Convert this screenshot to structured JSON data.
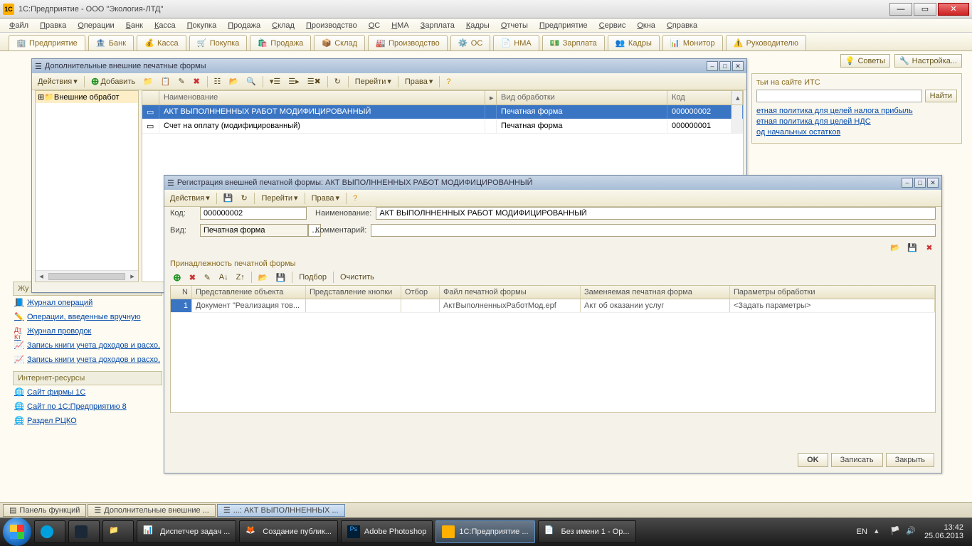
{
  "titlebar": {
    "app": "1С:Предприятие - ООО \"Экология-ЛТД\""
  },
  "menubar": [
    "Файл",
    "Правка",
    "Операции",
    "Банк",
    "Касса",
    "Покупка",
    "Продажа",
    "Склад",
    "Производство",
    "ОС",
    "НМА",
    "Зарплата",
    "Кадры",
    "Отчеты",
    "Предприятие",
    "Сервис",
    "Окна",
    "Справка"
  ],
  "tabs": [
    "Предприятие",
    "Банк",
    "Касса",
    "Покупка",
    "Продажа",
    "Склад",
    "Производство",
    "ОС",
    "НМА",
    "Зарплата",
    "Кадры",
    "Монитор",
    "Руководителю"
  ],
  "right": {
    "tips": "Советы",
    "setup": "Настройка...",
    "section_title": "тьи на сайте ИТС",
    "search_btn": "Найти",
    "links": [
      "етная политика для целей налога прибыль",
      "етная политика для целей НДС",
      "од начальных остатков"
    ]
  },
  "left": {
    "grp_journals": "Жу",
    "items1": [
      "Журнал операций",
      "Операции, введенные вручную",
      "Журнал проводок",
      "Запись книги учета доходов и расхо,",
      "Запись книги учета доходов и расхо,"
    ],
    "grp_inet": "Интернет-ресурсы",
    "items2": [
      "Сайт фирмы 1С",
      "Сайт по 1С:Предприятию 8",
      "Раздел РЦКО"
    ]
  },
  "win1": {
    "title": "Дополнительные внешние печатные формы",
    "actions": "Действия",
    "add": "Добавить",
    "goto": "Перейти",
    "rights": "Права",
    "tree_root": "Внешние обработ",
    "cols": {
      "name": "Наименование",
      "type": "Вид обработки",
      "code": "Код"
    },
    "rows": [
      {
        "name": "АКТ ВЫПОЛННЕННЫХ РАБОТ МОДИФИЦИРОВАННЫЙ",
        "type": "Печатная форма",
        "code": "000000002"
      },
      {
        "name": "Счет на оплату (модифицированный)",
        "type": "Печатная форма",
        "code": "000000001"
      }
    ]
  },
  "win2": {
    "title": "Регистрация внешней печатной формы: АКТ ВЫПОЛННЕННЫХ РАБОТ МОДИФИЦИРОВАННЫЙ",
    "actions": "Действия",
    "goto": "Перейти",
    "rights": "Права",
    "lbl_code": "Код:",
    "val_code": "000000002",
    "lbl_name": "Наименование:",
    "val_name": "АКТ ВЫПОЛННЕННЫХ РАБОТ МОДИФИЦИРОВАННЫЙ",
    "lbl_kind": "Вид:",
    "val_kind": "Печатная форма",
    "lbl_comment": "Комментарий:",
    "val_comment": "",
    "belong": "Принадлежность печатной формы",
    "tb_select": "Подбор",
    "tb_clear": "Очистить",
    "cols": {
      "n": "N",
      "obj": "Представление объекта",
      "btn": "Представление кнопки",
      "sel": "Отбор",
      "file": "Файл печатной формы",
      "repl": "Заменяемая печатная форма",
      "par": "Параметры обработки"
    },
    "row": {
      "n": "1",
      "obj": "Документ \"Реализация тов...",
      "btn": "",
      "sel": "",
      "file": "АктВыполненныхРаботМод.epf",
      "repl": "Акт об оказании услуг",
      "par": "<Задать параметры>"
    },
    "ok": "OK",
    "write": "Записать",
    "close": "Закрыть"
  },
  "wintabs": {
    "panel": "Панель функций",
    "w1": "Дополнительные внешние ...",
    "w2": "...: АКТ ВЫПОЛННЕННЫХ ..."
  },
  "taskbar": {
    "items": [
      "Диспетчер задач ...",
      "Создание публик...",
      "Adobe Photoshop",
      "1С:Предприятие ...",
      "Без имени 1 - Op..."
    ],
    "lang": "EN",
    "time": "13:42",
    "date": "25.06.2013"
  }
}
